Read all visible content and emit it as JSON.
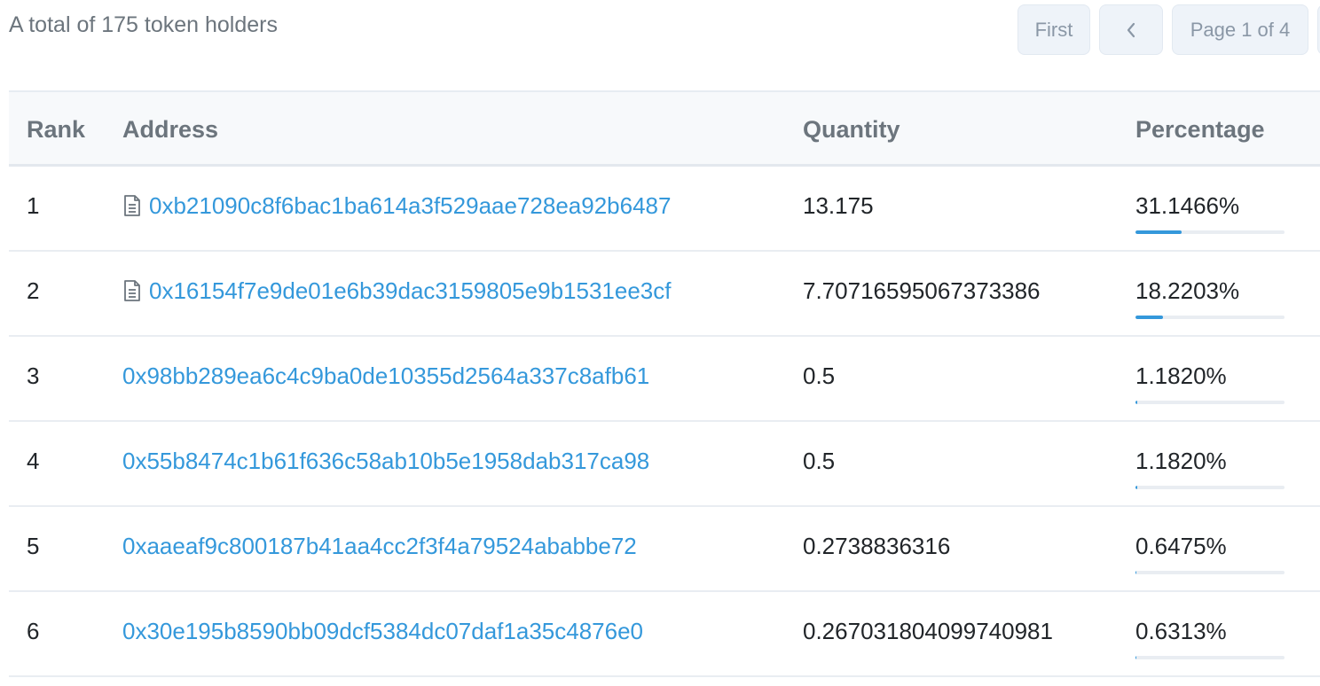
{
  "summary": "A total of 175 token holders",
  "pagination": {
    "first_label": "First",
    "prev_icon": "chevron-left-icon",
    "page_info": "Page 1 of 4"
  },
  "columns": {
    "rank": "Rank",
    "address": "Address",
    "quantity": "Quantity",
    "percentage": "Percentage"
  },
  "holders": [
    {
      "rank": "1",
      "address": "0xb21090c8f6bac1ba614a3f529aae728ea92b6487",
      "is_contract": true,
      "quantity": "13.175",
      "percentage": "31.1466%",
      "share": 31.1466
    },
    {
      "rank": "2",
      "address": "0x16154f7e9de01e6b39dac3159805e9b1531ee3cf",
      "is_contract": true,
      "quantity": "7.70716595067373386",
      "percentage": "18.2203%",
      "share": 18.2203
    },
    {
      "rank": "3",
      "address": "0x98bb289ea6c4c9ba0de10355d2564a337c8afb61",
      "is_contract": false,
      "quantity": "0.5",
      "percentage": "1.1820%",
      "share": 1.182
    },
    {
      "rank": "4",
      "address": "0x55b8474c1b61f636c58ab10b5e1958dab317ca98",
      "is_contract": false,
      "quantity": "0.5",
      "percentage": "1.1820%",
      "share": 1.182
    },
    {
      "rank": "5",
      "address": "0xaaeaf9c800187b41aa4cc2f3f4a79524ababbe72",
      "is_contract": false,
      "quantity": "0.2738836316",
      "percentage": "0.6475%",
      "share": 0.6475
    },
    {
      "rank": "6",
      "address": "0x30e195b8590bb09dcf5384dc07daf1a35c4876e0",
      "is_contract": false,
      "quantity": "0.267031804099740981",
      "percentage": "0.6313%",
      "share": 0.6313
    }
  ],
  "colors": {
    "link": "#3498db",
    "bar": "#3498db",
    "muted": "#6c757d"
  }
}
